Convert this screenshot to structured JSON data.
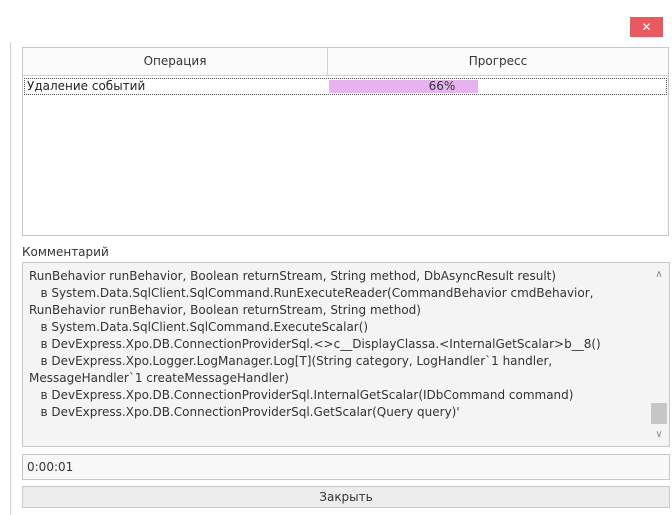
{
  "title_bar": {
    "close_glyph": "✕"
  },
  "grid": {
    "columns": [
      "Операция",
      "Прогресс"
    ],
    "rows": [
      {
        "operation": "Удаление событий",
        "progress_text": "66%",
        "progress_value": 0.66
      }
    ],
    "progress_color": "#e6b3f0"
  },
  "comment": {
    "label": "Комментарий",
    "text": "RunBehavior runBehavior, Boolean returnStream, String method, DbAsyncResult result)\n   в System.Data.SqlClient.SqlCommand.RunExecuteReader(CommandBehavior cmdBehavior,\nRunBehavior runBehavior, Boolean returnStream, String method)\n   в System.Data.SqlClient.SqlCommand.ExecuteScalar()\n   в DevExpress.Xpo.DB.ConnectionProviderSql.<>c__DisplayClassa.<InternalGetScalar>b__8()\n   в DevExpress.Xpo.Logger.LogManager.Log[T](String category, LogHandler`1 handler,\nMessageHandler`1 createMessageHandler)\n   в DevExpress.Xpo.DB.ConnectionProviderSql.InternalGetScalar(IDbCommand command)\n   в DevExpress.Xpo.DB.ConnectionProviderSql.GetScalar(Query query)'",
    "scroll_up_glyph": "∧",
    "scroll_down_glyph": "∨"
  },
  "elapsed_time": "0:00:01",
  "close_button_label": "Закрыть",
  "colors": {
    "close_red": "#e9595d"
  }
}
